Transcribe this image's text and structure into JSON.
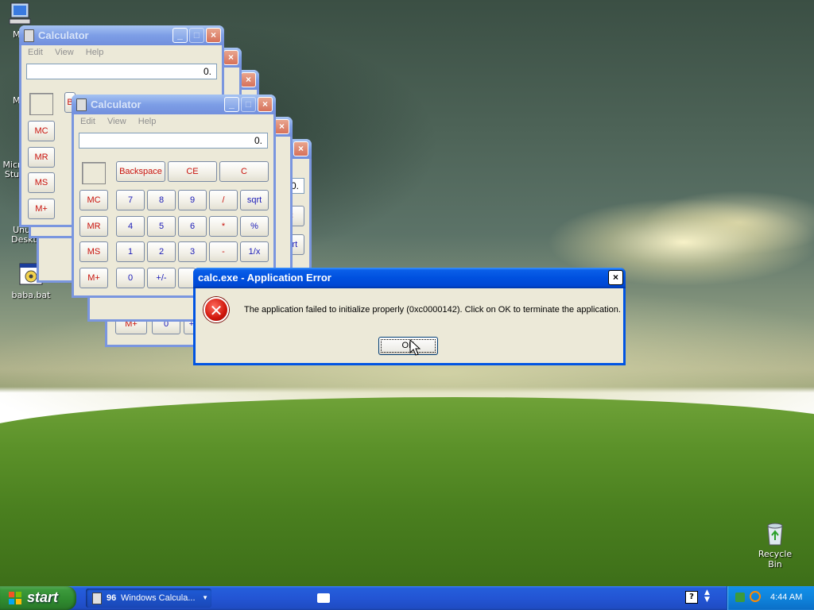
{
  "desktop": {
    "icons": [
      {
        "label": "My"
      },
      {
        "label": "M"
      },
      {
        "label": "Micr Stu"
      },
      {
        "label": "Unus Deskt"
      },
      {
        "label": "baba.bat"
      },
      {
        "label": "Recycle Bin"
      }
    ]
  },
  "calculator": {
    "title": "Calculator",
    "menu": [
      "Edit",
      "View",
      "Help"
    ],
    "display": "0.",
    "memory_buttons": [
      "MC",
      "MR",
      "MS",
      "M+"
    ],
    "top_buttons": [
      "Backspace",
      "CE",
      "C"
    ],
    "rows": [
      [
        "7",
        "8",
        "9",
        "/",
        "sqrt"
      ],
      [
        "4",
        "5",
        "6",
        "*",
        "%"
      ],
      [
        "1",
        "2",
        "3",
        "-",
        "1/x"
      ],
      [
        "0",
        "+/-"
      ]
    ],
    "back_partial": {
      "b": "B",
      "c": "C",
      "sqrt": "sqrt",
      "ms": "MS",
      "mplus": "M+",
      "zero": "0",
      "plus": "+"
    }
  },
  "error_dialog": {
    "title": "calc.exe - Application Error",
    "message": "The application failed to initialize properly (0xc0000142). Click on OK to terminate the application.",
    "ok_label": "OK",
    "icon": "error-icon",
    "close": "×"
  },
  "taskbar": {
    "start_label": "start",
    "group": {
      "count": "96",
      "label": "Windows Calcula..."
    },
    "help_icon": "?",
    "clock": "4:44 AM"
  }
}
